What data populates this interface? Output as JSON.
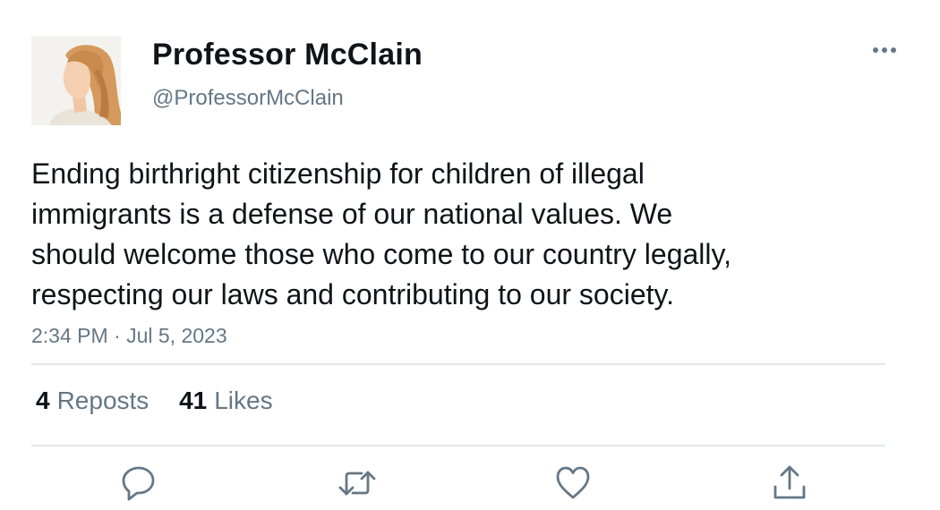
{
  "tweet": {
    "author": {
      "display_name": "Professor McClain",
      "handle": "@ProfessorMcClain"
    },
    "text": "Ending birthright citizenship for children of illegal\nimmigrants is a defense of our national values. We\nshould welcome those who come to our country legally,\nrespecting our laws and contributing to our society.",
    "timestamp": "2:34 PM · Jul 5, 2023",
    "stats": {
      "reposts_count": "4",
      "reposts_label": "Reposts",
      "likes_count": "41",
      "likes_label": "Likes"
    },
    "actions": [
      "reply-icon",
      "repost-icon",
      "like-icon",
      "share-icon"
    ]
  },
  "colors": {
    "text": "#0f1419",
    "secondary": "#657786",
    "divider": "#e1e8ed"
  }
}
